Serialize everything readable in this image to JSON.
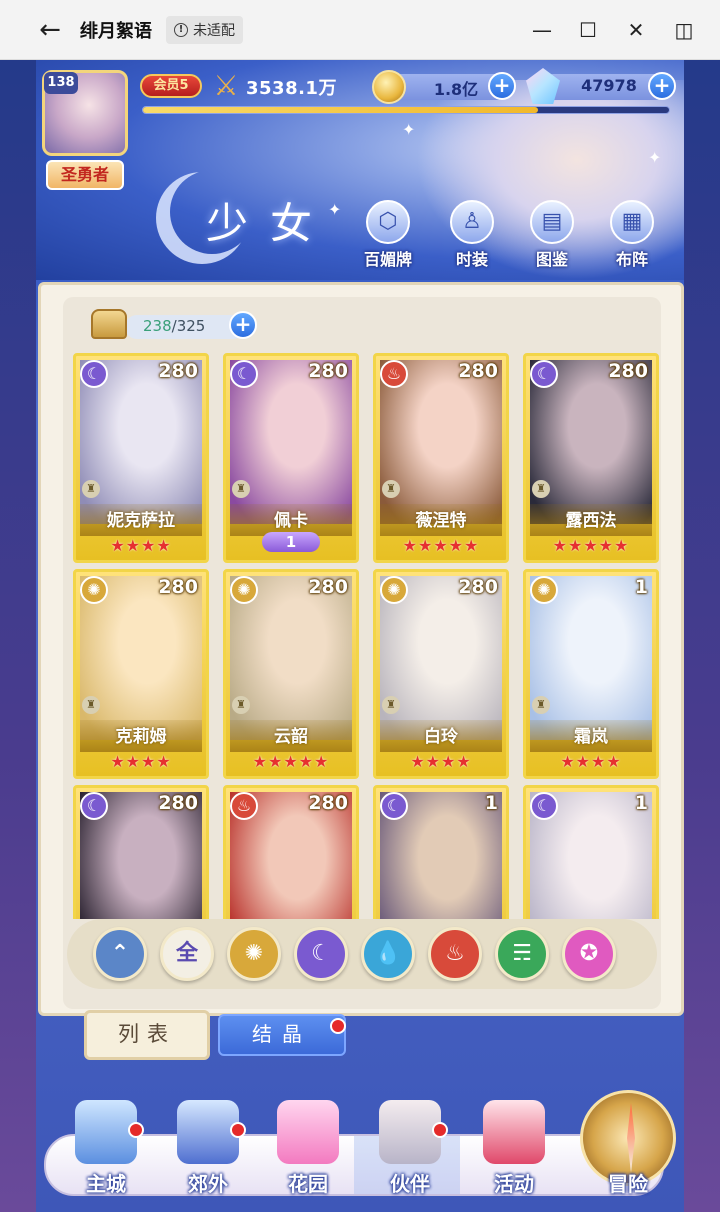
{
  "window": {
    "title": "绯月絮语",
    "badge": "未适配"
  },
  "header": {
    "level": "138",
    "player_title": "圣勇者",
    "vip": "会员5",
    "power": "3538.1万",
    "power_progress": 0.75,
    "gold": "1.8亿",
    "gems": "47978"
  },
  "section": {
    "title": "少女",
    "buttons": [
      {
        "label": "百媚牌",
        "icon": "card-deck-icon"
      },
      {
        "label": "时装",
        "icon": "costume-icon"
      },
      {
        "label": "图鉴",
        "icon": "book-icon"
      },
      {
        "label": "布阵",
        "icon": "formation-grid-icon"
      }
    ]
  },
  "capacity": {
    "current": "238",
    "max": "/325"
  },
  "colors": {
    "moon": "#7a5ad0",
    "light": "#d8a83a",
    "water": "#3aa6d8",
    "fire": "#d84a3a",
    "wind": "#3aa85a",
    "star": "#e05ac0"
  },
  "cards": [
    {
      "name": "妮克萨拉",
      "level": "280",
      "element": "moon",
      "stars": "★★★★",
      "art": [
        "#e9e6f2",
        "#8f8cb6"
      ]
    },
    {
      "name": "佩卡",
      "level": "280",
      "element": "moon",
      "stars": "",
      "pin": "1",
      "art": [
        "#f1cfd6",
        "#8a4aa0"
      ]
    },
    {
      "name": "薇涅特",
      "level": "280",
      "element": "fire",
      "stars": "★★★★★",
      "art": [
        "#f4d3c6",
        "#8a5a3a"
      ]
    },
    {
      "name": "露西法",
      "level": "280",
      "element": "moon",
      "stars": "★★★★★",
      "art": [
        "#c9b4be",
        "#2a2a3a"
      ]
    },
    {
      "name": "克莉姆",
      "level": "280",
      "element": "light",
      "stars": "★★★★",
      "art": [
        "#fbe6c0",
        "#d9b86a"
      ]
    },
    {
      "name": "云韶",
      "level": "280",
      "element": "light",
      "stars": "★★★★★",
      "art": [
        "#f1ddc6",
        "#b8aa86"
      ]
    },
    {
      "name": "白玲",
      "level": "280",
      "element": "light",
      "stars": "★★★★",
      "art": [
        "#f4eee8",
        "#b8b4bc"
      ]
    },
    {
      "name": "霜岚",
      "level": "1",
      "element": "light",
      "stars": "★★★★",
      "art": [
        "#eef3fb",
        "#a8c0e6"
      ]
    },
    {
      "name": "",
      "level": "280",
      "element": "moon",
      "stars": "",
      "art": [
        "#c8b0c0",
        "#2a2230"
      ]
    },
    {
      "name": "",
      "level": "280",
      "element": "fire",
      "stars": "",
      "art": [
        "#f2c8b8",
        "#b8302a"
      ]
    },
    {
      "name": "",
      "level": "1",
      "element": "moon",
      "stars": "",
      "art": [
        "#e2cbb6",
        "#6a5a7a"
      ]
    },
    {
      "name": "",
      "level": "1",
      "element": "moon",
      "stars": "",
      "art": [
        "#f4ecef",
        "#b8b4c8"
      ]
    }
  ],
  "filters": [
    {
      "icon": "wind-arrow-icon",
      "label": "",
      "color": "#5b86c8"
    },
    {
      "icon": "all-icon",
      "label": "全",
      "color": "#f3efe4"
    },
    {
      "icon": "light-icon",
      "label": "",
      "color": "#d8a83a"
    },
    {
      "icon": "moon-icon",
      "label": "",
      "color": "#7a5ad0"
    },
    {
      "icon": "water-icon",
      "label": "",
      "color": "#3aa6d8"
    },
    {
      "icon": "fire-icon",
      "label": "",
      "color": "#d84a3a"
    },
    {
      "icon": "wind-icon",
      "label": "",
      "color": "#3aa85a"
    },
    {
      "icon": "star-icon",
      "label": "",
      "color": "#e05ac0"
    }
  ],
  "tabs": {
    "list": "列表",
    "crystal": "结晶"
  },
  "nav": [
    {
      "label": "主城",
      "icon": "castle-icon",
      "dot": true
    },
    {
      "label": "郊外",
      "icon": "portal-icon",
      "dot": true
    },
    {
      "label": "花园",
      "icon": "heart-icon",
      "dot": false
    },
    {
      "label": "伙伴",
      "icon": "partner-icon",
      "dot": true
    },
    {
      "label": "活动",
      "icon": "gift-icon",
      "dot": false
    },
    {
      "label": "冒险",
      "icon": "compass-icon",
      "dot": false
    }
  ]
}
